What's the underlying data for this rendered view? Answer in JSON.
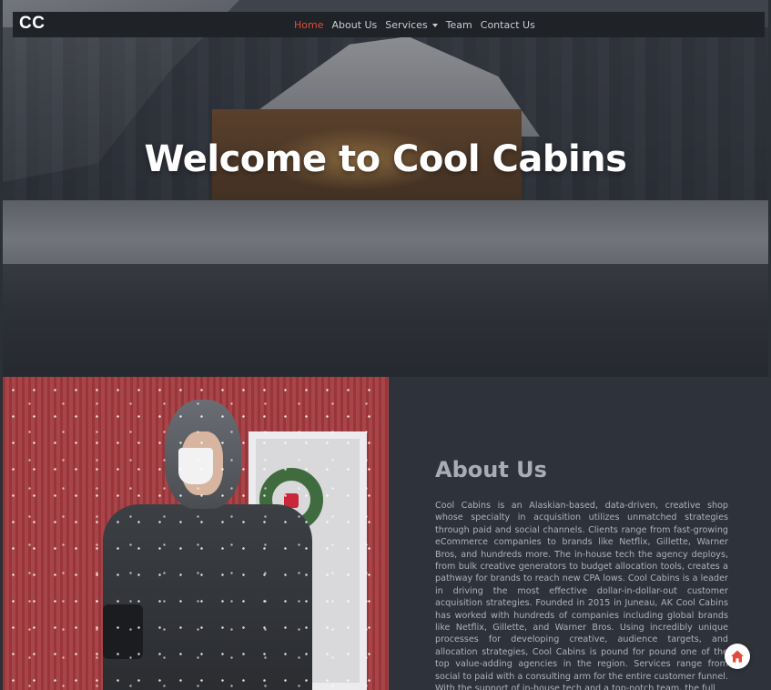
{
  "brand": {
    "logo_text": "CC"
  },
  "nav": {
    "items": [
      {
        "label": "Home",
        "active": true
      },
      {
        "label": "About Us",
        "active": false
      },
      {
        "label": "Services",
        "active": false,
        "dropdown": true
      },
      {
        "label": "Team",
        "active": false
      },
      {
        "label": "Contact Us",
        "active": false
      }
    ],
    "active_color": "#e14b3b"
  },
  "hero": {
    "title": "Welcome to Cool Cabins"
  },
  "about": {
    "title": "About Us",
    "body": "Cool Cabins is an Alaskian-based, data-driven, creative shop whose specialty in acquisition utilizes unmatched strategies through paid and social channels. Clients range from fast-growing eCommerce companies to brands like Netflix, Gillette, Warner Bros, and hundreds more. The in-house tech the agency deploys, from bulk creative generators to budget allocation tools, creates a pathway for brands to reach new CPA lows. Cool Cabins is a leader in driving the most effective dollar-in-dollar-out customer acquisition strategies. Founded in 2015 in Juneau, AK Cool Cabins has worked with hundreds of companies including global brands like Netflix, Gillette, and Warner Bros. Using incredibly unique processes for developing creative, audience targets, and allocation strategies, Cool Cabins is pound for pound one of the top value-adding agencies in the region. Services range from social to paid with a consulting arm for the entire customer funnel. With the support of in-house tech and a top-notch team, the full"
  },
  "icons": {
    "home_button": "home-icon"
  },
  "colors": {
    "navbar_bg": "#1f2227",
    "panel_bg": "#2d323b",
    "accent": "#e14b3b"
  }
}
